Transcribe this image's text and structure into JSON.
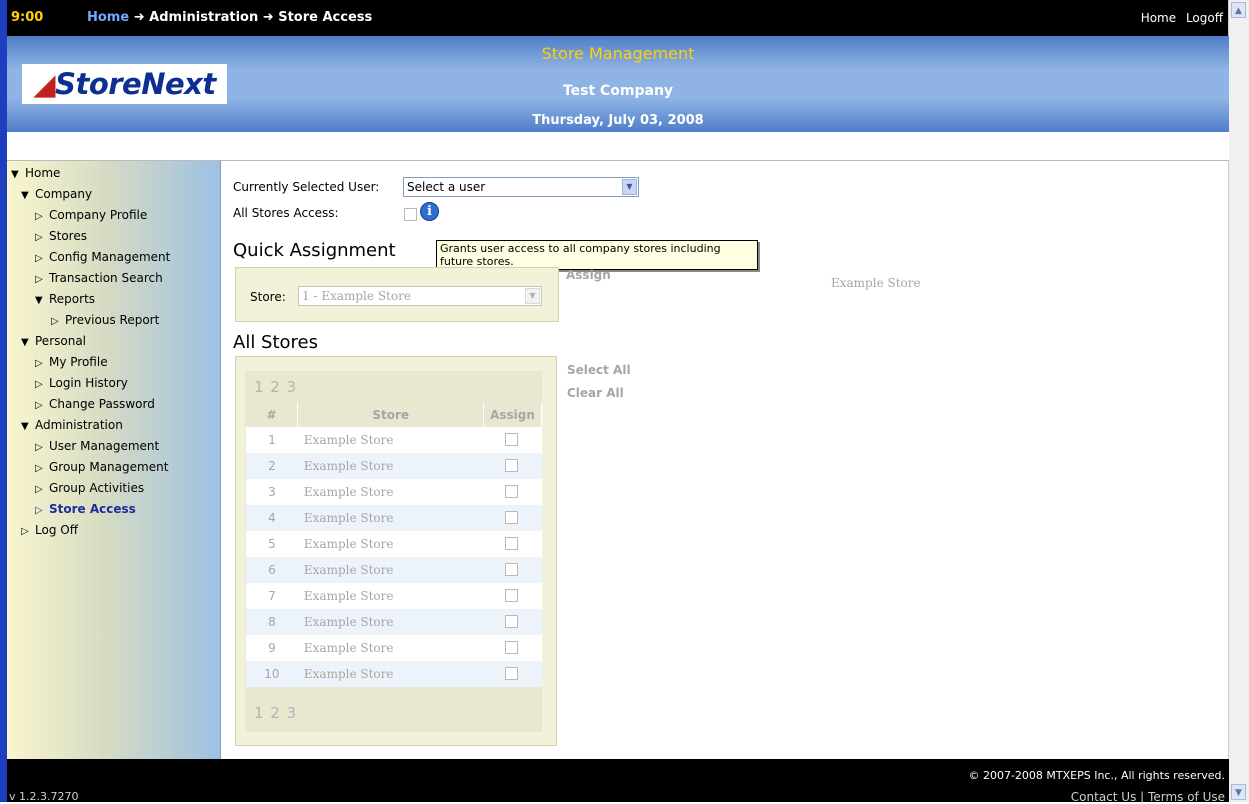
{
  "topbar": {
    "time": "9:00",
    "breadcrumb_home": "Home",
    "breadcrumb_arrow1": "➜",
    "breadcrumb_admin": "Administration",
    "breadcrumb_arrow2": "➜",
    "breadcrumb_current": "Store Access",
    "link_home": "Home",
    "link_logoff": "Logoff"
  },
  "header": {
    "logo_mark": "🞃",
    "logo_text": "StoreNext",
    "title": "Store Management",
    "company": "Test Company",
    "date": "Thursday, July 03, 2008"
  },
  "sidebar": {
    "items": [
      {
        "label": "Home",
        "icon": "▼"
      },
      {
        "label": "Company",
        "icon": "▼"
      },
      {
        "label": "Company Profile",
        "icon": "▷"
      },
      {
        "label": "Stores",
        "icon": "▷"
      },
      {
        "label": "Config Management",
        "icon": "▷"
      },
      {
        "label": "Transaction Search",
        "icon": "▷"
      },
      {
        "label": "Reports",
        "icon": "▼"
      },
      {
        "label": "Previous Report",
        "icon": "▷"
      },
      {
        "label": "Personal",
        "icon": "▼"
      },
      {
        "label": "My Profile",
        "icon": "▷"
      },
      {
        "label": "Login History",
        "icon": "▷"
      },
      {
        "label": "Change Password",
        "icon": "▷"
      },
      {
        "label": "Administration",
        "icon": "▼"
      },
      {
        "label": "User Management",
        "icon": "▷"
      },
      {
        "label": "Group Management",
        "icon": "▷"
      },
      {
        "label": "Group Activities",
        "icon": "▷"
      },
      {
        "label": "Store Access",
        "icon": "▷"
      },
      {
        "label": "Log Off",
        "icon": "▷"
      }
    ]
  },
  "main": {
    "selected_user_label": "Currently Selected User:",
    "selected_user_value": "Select a user",
    "all_stores_label": "All Stores Access:",
    "tooltip": "Grants user access to all company stores including future stores.",
    "quick_assignment_title": "Quick Assignment",
    "qa_store_label": "Store:",
    "qa_store_value": "1 - Example Store",
    "assign_link": "Assign",
    "assign_store_name": "Example Store",
    "all_stores_title": "All Stores",
    "select_all": "Select All",
    "clear_all": "Clear All",
    "pager": "1 2 3",
    "table": {
      "headers": [
        "#",
        "Store",
        "Assign"
      ],
      "rows": [
        {
          "num": "1",
          "name": "Example Store"
        },
        {
          "num": "2",
          "name": "Example Store"
        },
        {
          "num": "3",
          "name": "Example Store"
        },
        {
          "num": "4",
          "name": "Example Store"
        },
        {
          "num": "5",
          "name": "Example Store"
        },
        {
          "num": "6",
          "name": "Example Store"
        },
        {
          "num": "7",
          "name": "Example Store"
        },
        {
          "num": "8",
          "name": "Example Store"
        },
        {
          "num": "9",
          "name": "Example Store"
        },
        {
          "num": "10",
          "name": "Example Store"
        }
      ]
    }
  },
  "footer": {
    "version": "v 1.2.3.7270",
    "copyright": "© 2007-2008 MTXEPS Inc., All rights reserved.",
    "contact": "Contact Us",
    "separator": "|",
    "terms": "Terms of Use"
  },
  "colors": {
    "accent_yellow": "#ffd200",
    "brand_blue": "#0d2f8f",
    "brand_red": "#c0211b",
    "active_nav": "#1a2d9a"
  }
}
